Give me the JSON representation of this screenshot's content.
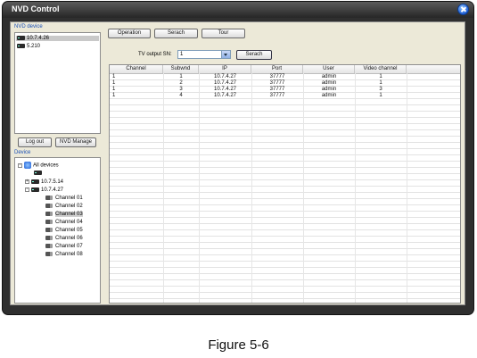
{
  "window": {
    "title": "NVD Control"
  },
  "nvd_panel": {
    "label": "NVD device",
    "items": [
      {
        "label": "10.7.4.26",
        "selected": true
      },
      {
        "label": "5.210",
        "selected": false
      }
    ],
    "logout_label": "Log out",
    "manage_label": "NVD Manage"
  },
  "device_panel": {
    "label": "Device",
    "root_label": "All devices",
    "node_blank": "",
    "node_a": "10.7.5.14",
    "node_b": "10.7.4.27",
    "channels": [
      "Channel 01",
      "Channel 02",
      "Channel 03",
      "Channel 04",
      "Channel 05",
      "Channel 06",
      "Channel 07",
      "Channel 08"
    ],
    "selected_channel": "Channel 03"
  },
  "tabs": {
    "operation": "Operation",
    "search": "Serach",
    "tour": "Tour"
  },
  "tv_output": {
    "label": "TV output SN:",
    "value": "1",
    "search_label": "Serach"
  },
  "table": {
    "columns": [
      "Channel",
      "Subwnd",
      "IP",
      "Port",
      "User",
      "Video channel"
    ],
    "rows": [
      [
        "1",
        "1",
        "10.7.4.27",
        "37777",
        "admin",
        "1"
      ],
      [
        "1",
        "2",
        "10.7.4.27",
        "37777",
        "admin",
        "1"
      ],
      [
        "1",
        "3",
        "10.7.4.27",
        "37777",
        "admin",
        "3"
      ],
      [
        "1",
        "4",
        "10.7.4.27",
        "37777",
        "admin",
        "1"
      ]
    ]
  },
  "caption": "Figure 5-6",
  "colors": {
    "titlebar": "#262626",
    "client": "#ece9d8",
    "label_blue": "#1a4fb5",
    "close_button": "#1f5fd6"
  }
}
